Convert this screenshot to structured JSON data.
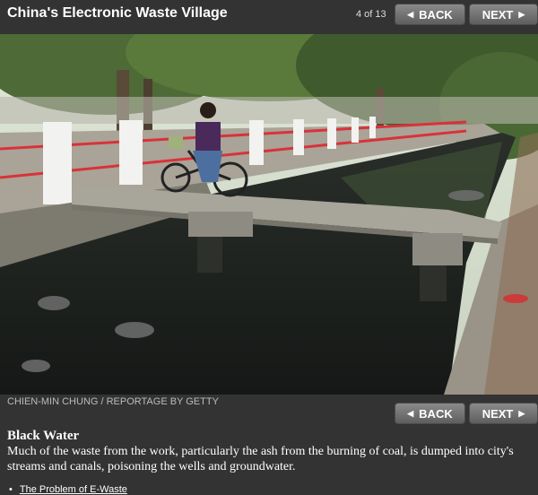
{
  "header": {
    "title": "China's Electronic Waste Village",
    "counter": "4 of 13",
    "back_label": "BACK",
    "next_label": "NEXT"
  },
  "photo": {
    "alt": "Person on a bicycle crossing a concrete slab bridge over a blackened canal lined with trees and white railings",
    "credit": "CHIEN-MIN CHUNG / REPORTAGE BY GETTY"
  },
  "caption": {
    "heading": "Black Water",
    "body": "Much of the waste from the work, particularly the ash from the burning of coal, is dumped into city's streams and canals, poisoning the wells and groundwater."
  },
  "nav_bottom": {
    "back_label": "BACK",
    "next_label": "NEXT"
  },
  "related": [
    {
      "label": "The Problem of E-Waste"
    }
  ],
  "colors": {
    "background": "#333333",
    "button_top": "#8a8a8a",
    "button_bottom": "#5e5e5e",
    "credit_text": "#bbbbbb"
  },
  "icons": {
    "back": "triangle-left-icon",
    "next": "triangle-right-icon"
  }
}
